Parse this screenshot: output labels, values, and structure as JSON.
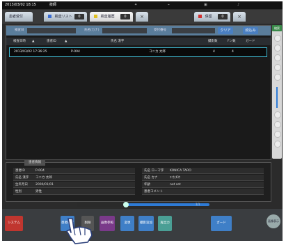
{
  "status_bar": {
    "datetime": "2013/03/02 18:15",
    "user": "技師"
  },
  "tabs": [
    {
      "label": "患者受付",
      "count": ""
    },
    {
      "label": "検査リスト",
      "count": "0"
    },
    {
      "label": "検査履歴",
      "count": "0"
    },
    {
      "label": "保留",
      "count": "0"
    }
  ],
  "search": {
    "exam_date_label": "検査日",
    "name_label": "氏名(カナ)",
    "accept_no_label": "受付番号",
    "clear_label": "クリア",
    "search_label": "絞込み",
    "aux_label": "検索"
  },
  "table": {
    "columns": [
      "検査日時",
      "患者ID",
      "氏名 漢字",
      "撮影数",
      "Fン数",
      "ガード"
    ],
    "rows": [
      {
        "datetime": "2013/03/02 17:36:25",
        "patient_id": "P-004",
        "name": "コニカ 太郎",
        "count1": "4",
        "count2": "4",
        "guard": ""
      }
    ]
  },
  "info": {
    "tab_label": "患者情報",
    "left": [
      {
        "key": "患者ID",
        "value": "P-004"
      },
      {
        "key": "氏名 漢字",
        "value": "コニカ 太郎"
      },
      {
        "key": "生年月日",
        "value": "2000/01/01"
      },
      {
        "key": "性別",
        "value": "男性"
      }
    ],
    "right": [
      {
        "key": "氏名 ローマ字",
        "value": "KONICA TARO"
      },
      {
        "key": "氏名 カナ",
        "value": "ｺﾆｶ ﾀﾛｳ"
      },
      {
        "key": "年齢",
        "value": "not set"
      },
      {
        "key": "患者コメント",
        "value": ""
      }
    ]
  },
  "scrub": {
    "left_label": "",
    "right_label": "1/1"
  },
  "toolbar": {
    "system_label": "システム",
    "btn1": "患者確認",
    "btn2": "削除",
    "btn3": "画像参照",
    "btn4": "変更",
    "btn5": "撮影追加",
    "btn6": "再出力",
    "btn7": "ガード",
    "circle": "画像表示"
  }
}
